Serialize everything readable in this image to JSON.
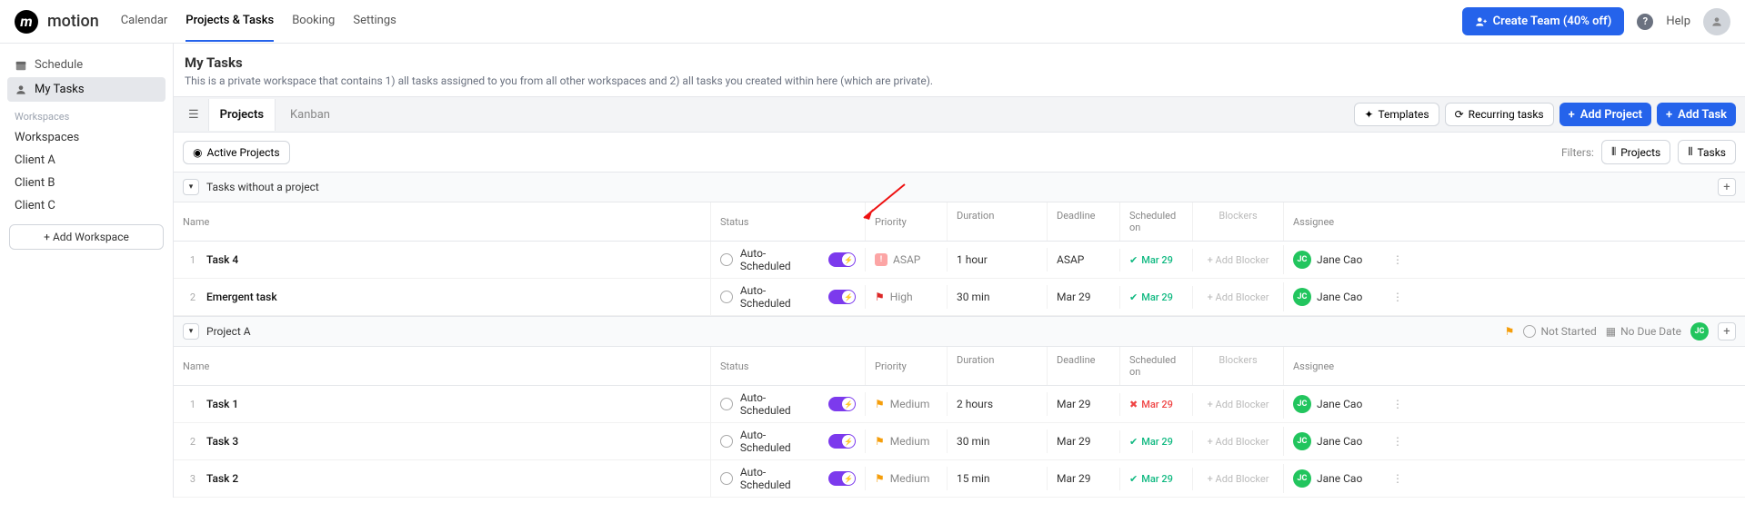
{
  "brand": "motion",
  "nav": {
    "calendar": "Calendar",
    "projects": "Projects & Tasks",
    "booking": "Booking",
    "settings": "Settings"
  },
  "topRight": {
    "createTeam": "Create Team (40% off)",
    "help": "Help"
  },
  "sidebar": {
    "schedule": "Schedule",
    "myTasks": "My Tasks",
    "workspacesLabel": "Workspaces",
    "workspaces": [
      "Workspaces",
      "Client A",
      "Client B",
      "Client C"
    ],
    "addWorkspace": "+   Add Workspace"
  },
  "page": {
    "title": "My Tasks",
    "desc": "This is a private workspace that contains 1) all tasks assigned to you from all other workspaces and 2) all tasks you created within here (which are private)."
  },
  "tabs": {
    "projects": "Projects",
    "kanban": "Kanban"
  },
  "actions": {
    "templates": "Templates",
    "recurring": "Recurring tasks",
    "addProject": "Add Project",
    "addTask": "Add Task"
  },
  "filters": {
    "active": "Active Projects",
    "label": "Filters:",
    "projects": "Projects",
    "tasks": "Tasks"
  },
  "cols": {
    "name": "Name",
    "status": "Status",
    "priority": "Priority",
    "duration": "Duration",
    "deadline": "Deadline",
    "scheduled": "Scheduled on",
    "blockers": "Blockers",
    "assignee": "Assignee"
  },
  "addBlocker": "+ Add Blocker",
  "groups": [
    {
      "title": "Tasks without a project",
      "rows": [
        {
          "idx": "1",
          "name": "Task 4",
          "status": "Auto-Scheduled",
          "priority": "ASAP",
          "priType": "asap",
          "duration": "1 hour",
          "deadline": "ASAP",
          "sched": "Mar 29",
          "schedState": "ok",
          "assignee": "Jane Cao",
          "initials": "JC"
        },
        {
          "idx": "2",
          "name": "Emergent task",
          "status": "Auto-Scheduled",
          "priority": "High",
          "priType": "high",
          "duration": "30 min",
          "deadline": "Mar 29",
          "sched": "Mar 29",
          "schedState": "ok",
          "assignee": "Jane Cao",
          "initials": "JC"
        }
      ]
    },
    {
      "title": "Project A",
      "meta": {
        "status": "Not Started",
        "due": "No Due Date",
        "initials": "JC"
      },
      "rows": [
        {
          "idx": "1",
          "name": "Task 1",
          "status": "Auto-Scheduled",
          "priority": "Medium",
          "priType": "med",
          "duration": "2 hours",
          "deadline": "Mar 29",
          "sched": "Mar 29",
          "schedState": "warn",
          "assignee": "Jane Cao",
          "initials": "JC"
        },
        {
          "idx": "2",
          "name": "Task 3",
          "status": "Auto-Scheduled",
          "priority": "Medium",
          "priType": "med",
          "duration": "30 min",
          "deadline": "Mar 29",
          "sched": "Mar 29",
          "schedState": "ok",
          "assignee": "Jane Cao",
          "initials": "JC"
        },
        {
          "idx": "3",
          "name": "Task 2",
          "status": "Auto-Scheduled",
          "priority": "Medium",
          "priType": "med",
          "duration": "15 min",
          "deadline": "Mar 29",
          "sched": "Mar 29",
          "schedState": "ok",
          "assignee": "Jane Cao",
          "initials": "JC"
        }
      ]
    }
  ]
}
